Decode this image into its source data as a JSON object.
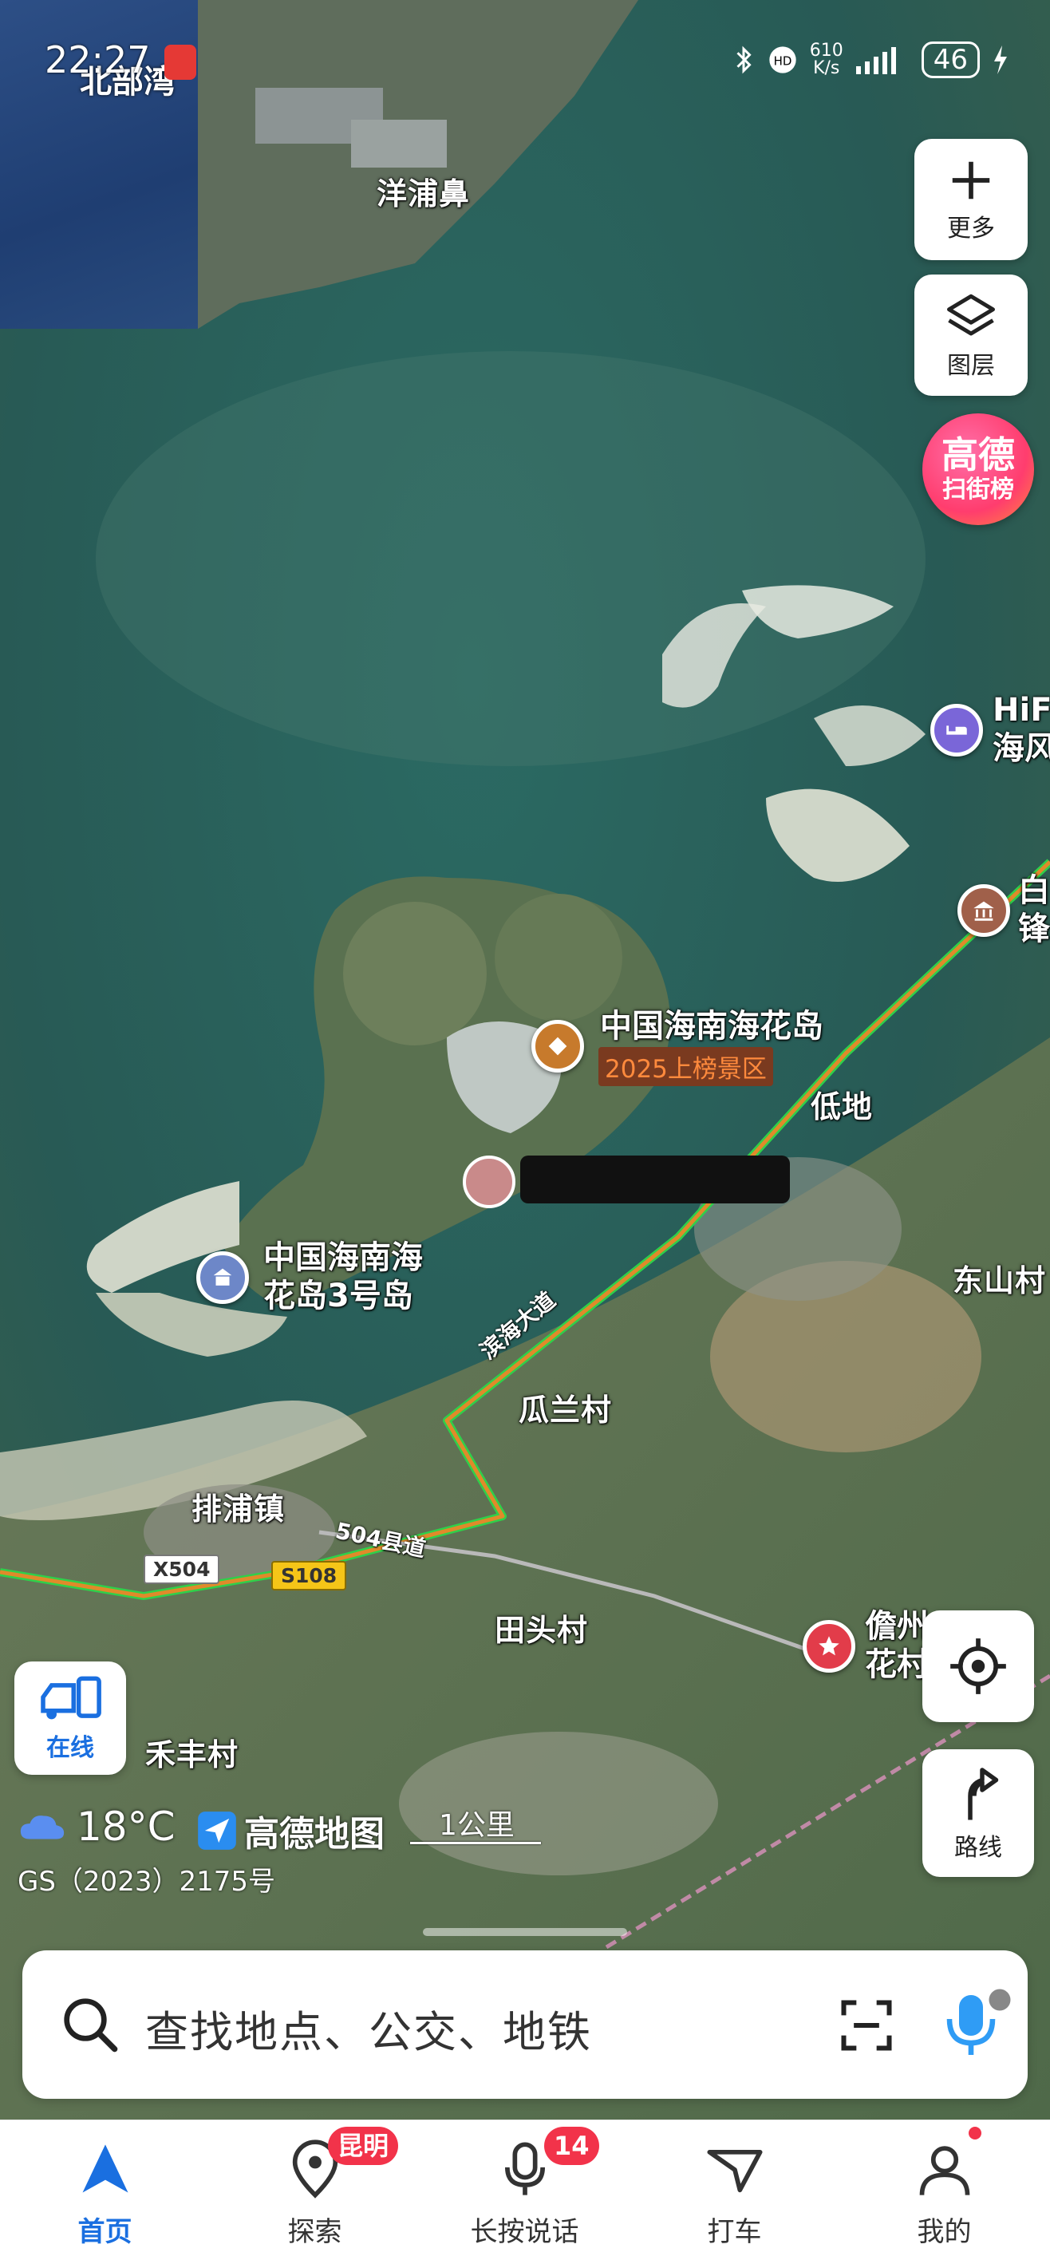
{
  "status_bar": {
    "time": "22:27",
    "net_speed": "610",
    "net_unit": "K/s",
    "battery": "46"
  },
  "thumbnail": {
    "title": "北部湾"
  },
  "map": {
    "places": {
      "yangpubi": "洋浦鼻",
      "didi": "低地",
      "dongshancun": "东山村",
      "gualancun": "瓜兰村",
      "paipuzhen": "排浦镇",
      "tiantoucun": "田头村",
      "hefengcun": "禾丰村"
    },
    "pois": {
      "haihuadao_main": {
        "label": "中国海南海花岛",
        "tag": "2025上榜景区"
      },
      "haihuadao_3": {
        "line1": "中国海南海",
        "line2": "花岛3号岛"
      },
      "hotel_partial": {
        "line1": "HiF",
        "line2": "海风"
      },
      "museum_partial": {
        "line1": "白",
        "line2": "锋"
      },
      "danzhou_partial": {
        "line1": "儋州",
        "line2": "花村"
      }
    },
    "roads": {
      "binhai": "滨海大道",
      "county504": "504县道",
      "x504": "X504",
      "s108": "S108"
    }
  },
  "controls": {
    "more": "更多",
    "layers": "图层",
    "rank_line1": "高德",
    "rank_line2": "扫街榜",
    "route": "路线",
    "online": "在线"
  },
  "footer_info": {
    "temperature": "18°C",
    "brand": "高德地图",
    "scale": "1公里",
    "license": "GS（2023）2175号"
  },
  "search": {
    "placeholder": "查找地点、公交、地铁"
  },
  "tabs": [
    {
      "label": "首页",
      "badge": ""
    },
    {
      "label": "探索",
      "badge": "昆明"
    },
    {
      "label": "长按说话",
      "badge": "14"
    },
    {
      "label": "打车",
      "badge": ""
    },
    {
      "label": "我的",
      "badge": ""
    }
  ],
  "colors": {
    "accent": "#1a6fe0",
    "badge": "#f2334a",
    "route_green": "#2fd04a",
    "route_orange": "#e08a2a"
  }
}
